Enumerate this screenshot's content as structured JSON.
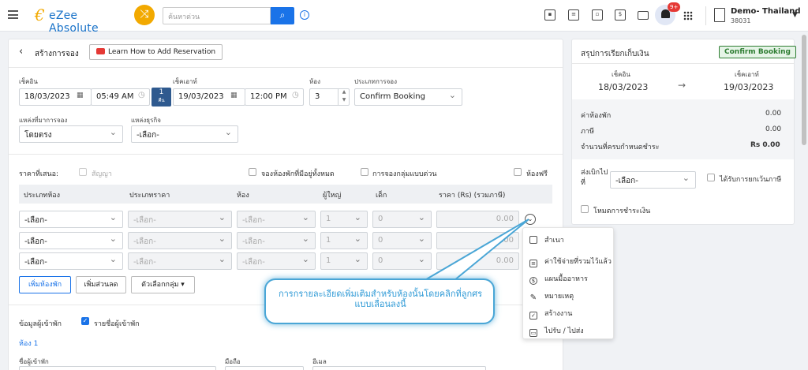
{
  "topbar": {
    "app_name": "eZee Absolute",
    "search_placeholder": "ค้นหาด่วน",
    "notification_count": "9+",
    "property_name": "Demo- Thailand",
    "property_id": "38031"
  },
  "header": {
    "back_icon": "chevron-left-icon",
    "title": "สร้างการจอง",
    "video_link": "Learn How to Add Reservation"
  },
  "dates": {
    "checkin_label": "เช็คอิน",
    "checkin_date": "18/03/2023",
    "checkin_time": "05:49 AM",
    "nights_value": "1",
    "nights_unit": "คืน",
    "checkout_label": "เช็คเอาท์",
    "checkout_date": "19/03/2023",
    "checkout_time": "12:00 PM",
    "rooms_label": "ห้อง",
    "rooms_value": "3",
    "booking_type_label": "ประเภทการจอง",
    "booking_type_value": "Confirm Booking"
  },
  "source": {
    "source_label": "แหล่งที่มาการจอง",
    "source_value": "โดยตรง",
    "business_label": "แหล่งธุรกิจ",
    "business_value": "-เลือก-"
  },
  "rates": {
    "offer_label": "ราคาที่เสนอ:",
    "contract_label": "สัญญา",
    "all_rooms_label": "จองห้องพักที่มีอยู่ทั้งหมด",
    "quick_group_label": "การจองกลุ่มแบบด่วน",
    "free_room_label": "ห้องฟรี"
  },
  "table": {
    "headers": [
      "ประเภทห้อง",
      "ประเภทราคา",
      "ห้อง",
      "ผู้ใหญ่",
      "เด็ก",
      "ราคา (Rs)  (รวมภาษี)"
    ],
    "rows": [
      {
        "room_type": "-เลือก-",
        "rate_type": "-เลือก-",
        "room": "-เลือก-",
        "adult": "1",
        "child": "0",
        "price": "0.00"
      },
      {
        "room_type": "-เลือก-",
        "rate_type": "-เลือก-",
        "room": "-เลือก-",
        "adult": "1",
        "child": "0",
        "price": "0.00"
      },
      {
        "room_type": "-เลือก-",
        "rate_type": "-เลือก-",
        "room": "-เลือก-",
        "adult": "1",
        "child": "0",
        "price": "0.00"
      }
    ]
  },
  "actions": {
    "add_room": "เพิ่มห้องพัก",
    "add_discount": "เพิ่มส่วนลด",
    "group_options": "ตัวเลือกกลุ่ม"
  },
  "guest": {
    "guest_info_label": "ข้อมูลผู้เข้าพัก",
    "guest_list_label": "รายชื่อผู้เข้าพัก",
    "room_label": "ห้อง 1",
    "name_label": "ชื่อผู้เข้าพัก",
    "mobile_label": "มือถือ",
    "email_label": "อีเมล"
  },
  "context_menu": {
    "items": [
      {
        "icon": "copy-icon",
        "label": "สำเนา"
      },
      {
        "icon": "receipt-icon",
        "label": "ค่าใช้จ่ายที่รวมไว้แล้ว"
      },
      {
        "icon": "dollar-icon",
        "label": "แผนมื้ออาหาร"
      },
      {
        "icon": "pencil-icon",
        "label": "หมายเหตุ"
      },
      {
        "icon": "task-icon",
        "label": "สร้างงาน"
      },
      {
        "icon": "car-icon",
        "label": "ไปรับ / ไปส่ง"
      }
    ]
  },
  "callout": {
    "text": "การกรายละเอียดเพิ่มเติมสำหรับห้องนั้นโดยคลิกที่ลูกศรแบบเลื่อนลงนี้"
  },
  "summary": {
    "title": "สรุปการเรียกเก็บเงิน",
    "status": "Confirm Booking",
    "checkin_label": "เช็คอิน",
    "checkin_date": "18/03/2023",
    "checkout_label": "เช็คเอาท์",
    "checkout_date": "19/03/2023",
    "room_charge_label": "ค่าห้องพัก",
    "room_charge_value": "0.00",
    "tax_label": "ภาษี",
    "tax_value": "0.00",
    "due_label": "จำนวนที่ครบกำหนดชำระ",
    "due_value": "Rs 0.00",
    "bill_to_label": "ส่งเบิกไปที่",
    "bill_to_value": "-เลือก-",
    "tax_exempt_label": "ได้รับการยกเว้นภาษี",
    "payment_mode_label": "โหมดการชำระเงิน"
  },
  "colors": {
    "accent": "#1a73e8",
    "brand_orange": "#f2a900",
    "status_green": "#2e7d32",
    "callout_blue": "#4aa6d6"
  }
}
